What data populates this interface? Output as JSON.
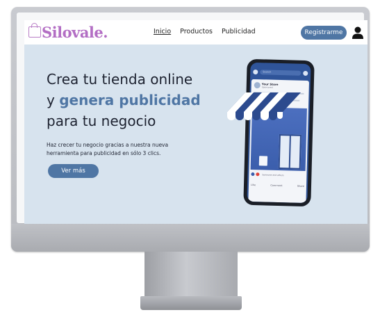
{
  "brand": {
    "name": "Silovale."
  },
  "nav": {
    "links": [
      "Inicio",
      "Productos",
      "Publicidad"
    ],
    "register_label": "Registrarme"
  },
  "hero": {
    "line1": "Crea tu  tienda online",
    "line2_prefix": "y ",
    "line2_accent": "genera publicidad",
    "line3": "para tu negocio",
    "subtitle_line1": "Haz crecer tu negocio gracias a nuestra nueva",
    "subtitle_line2": "herramienta para publicidad en sólo 3 clics.",
    "cta_label": "Ver más"
  },
  "phone": {
    "search_placeholder": "Search",
    "post_title": "Your Store",
    "post_sub": "Sponsored",
    "reactions_text": "Someone and others",
    "actions": [
      "Like",
      "Comment",
      "Share"
    ]
  },
  "colors": {
    "accent": "#4f76a4",
    "brand": "#b36ec4",
    "screen_bg": "#d7e3ee",
    "text": "#1d2230"
  }
}
